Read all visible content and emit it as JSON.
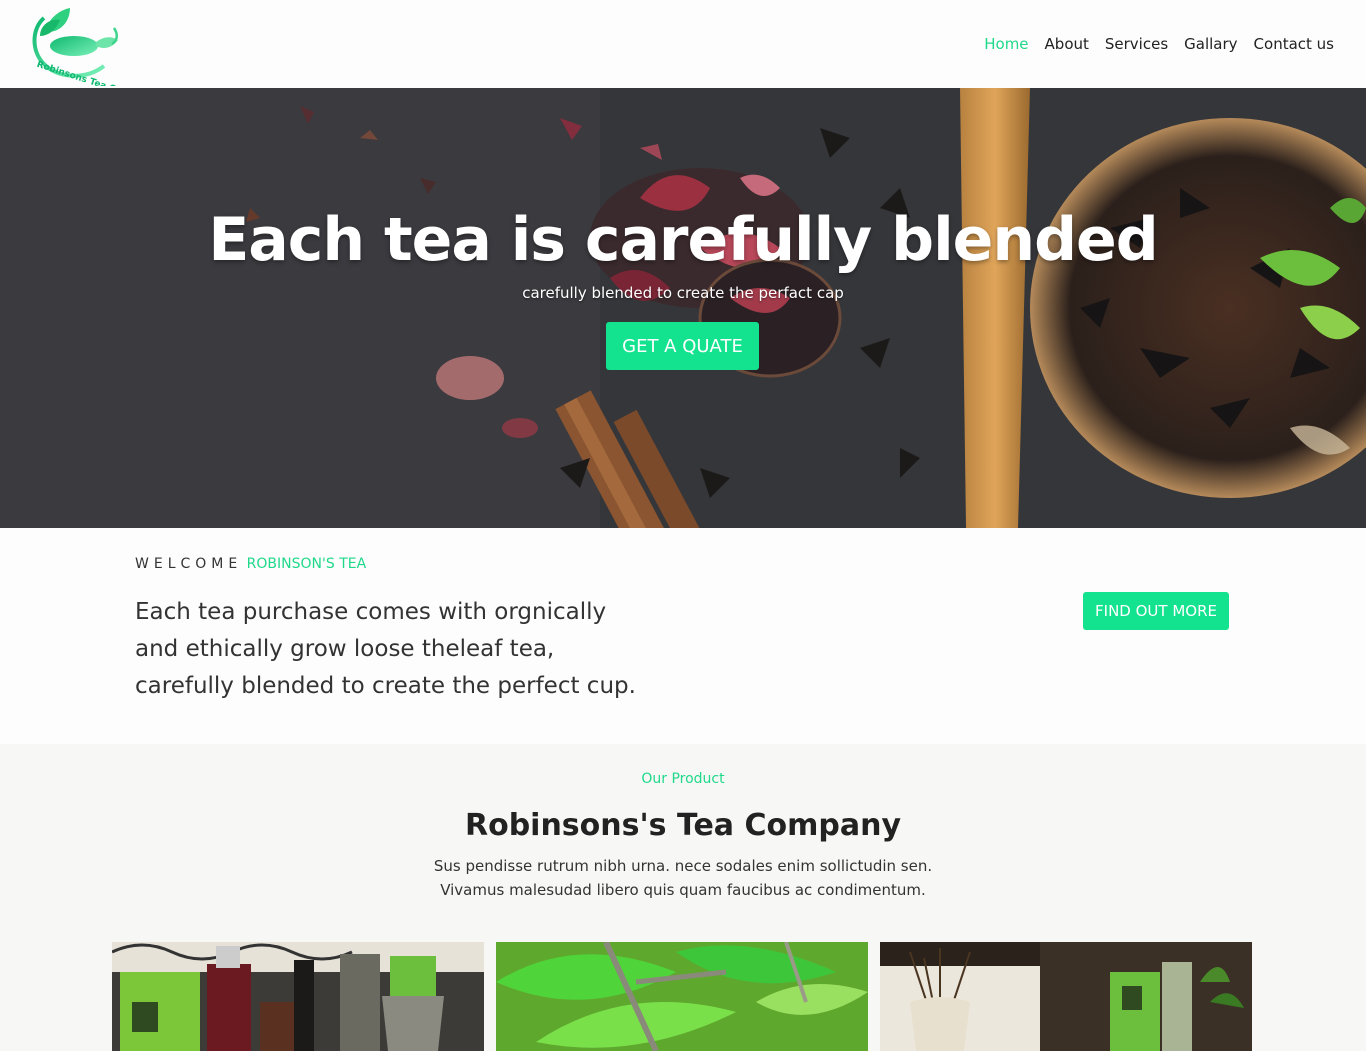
{
  "brand": {
    "logo_text": "Robinsons Tea Co.",
    "accent": "#13e28f"
  },
  "nav": {
    "items": [
      {
        "label": "Home",
        "active": true
      },
      {
        "label": "About",
        "active": false
      },
      {
        "label": "Services",
        "active": false
      },
      {
        "label": "Gallary",
        "active": false
      },
      {
        "label": "Contact us",
        "active": false
      }
    ]
  },
  "hero": {
    "title": "Each tea is carefully blended",
    "subtitle": "carefully blended to create the perfact cap",
    "button": "GET A QUATE"
  },
  "welcome": {
    "kicker_dark": "WELCOME",
    "kicker_green": "ROBINSON'S TEA",
    "text": "Each tea purchase comes with orgnically and ethically grow loose theleaf tea, carefully blended to create the perfect cup.",
    "button": "FIND OUT MORE"
  },
  "products": {
    "kicker": "Our Product",
    "title": "Robinsons's Tea Company",
    "description": "Sus pendisse rutrum nibh urna. nece sodales enim sollictudin sen. Vivamus malesudad libero quis quam faucibus ac condimentum.",
    "cards": [
      {
        "image": "tea-products-outdoor-photo"
      },
      {
        "image": "green-tea-leaves-photo"
      },
      {
        "image": "tea-products-vase-photo"
      }
    ]
  }
}
